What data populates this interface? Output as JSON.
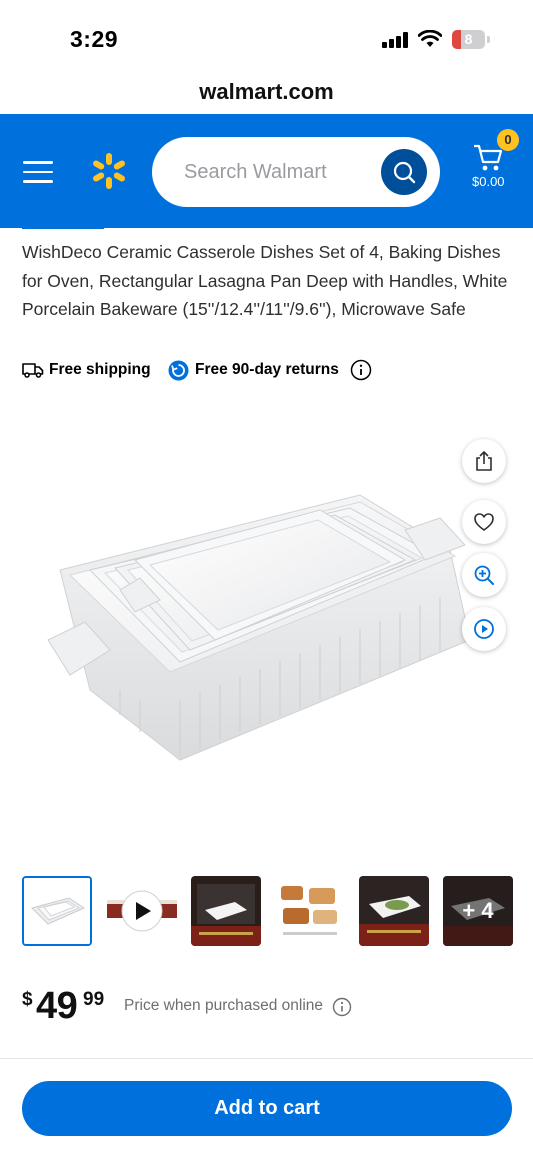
{
  "status_bar": {
    "time": "3:29",
    "battery": "8"
  },
  "browser": {
    "url": "walmart.com"
  },
  "header": {
    "search_placeholder": "Search Walmart",
    "cart_count": "0",
    "cart_total": "$0.00",
    "brand_color": "#0071dc",
    "spark_color": "#ffc220"
  },
  "product": {
    "title": "WishDeco Ceramic Casserole Dishes Set of 4, Baking Dishes for Oven, Rectangular Lasagna Pan Deep with Handles, White Porcelain Bakeware (15''/12.4''/11''/9.6''), Microwave Safe",
    "perks": {
      "shipping": "Free shipping",
      "returns": "Free 90-day returns"
    },
    "thumbnails_more": "+ 4",
    "price": {
      "dollar_sign": "$",
      "whole": "49",
      "cents": "99",
      "note": "Price when purchased online"
    }
  },
  "actions": {
    "add_to_cart": "Add to cart"
  }
}
